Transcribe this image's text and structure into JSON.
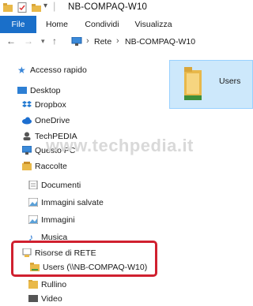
{
  "window": {
    "title": "NB-COMPAQ-W10"
  },
  "ribbon": {
    "tabs": [
      "File",
      "Home",
      "Condividi",
      "Visualizza"
    ]
  },
  "address": {
    "segments": [
      "Rete",
      "NB-COMPAQ-W10"
    ]
  },
  "nav": {
    "quick_access": "Accesso rapido",
    "desktop": "Desktop",
    "dropbox": "Dropbox",
    "onedrive": "OneDrive",
    "techpedia": "TechPEDIA",
    "this_pc": "Questo PC",
    "raccolte": "Raccolte",
    "documenti": "Documenti",
    "immagini_salvate": "Immagini salvate",
    "immagini": "Immagini",
    "musica": "Musica",
    "risorse_rete": "Risorse di RETE",
    "users_share": "Users (\\\\NB-COMPAQ-W10)",
    "rullino": "Rullino",
    "video": "Video"
  },
  "content": {
    "folder_label": "Users"
  },
  "watermark": "www.techpedia.it",
  "colors": {
    "accent": "#1a6fc9",
    "highlight": "#d0202f",
    "selection": "#cde8fb"
  }
}
